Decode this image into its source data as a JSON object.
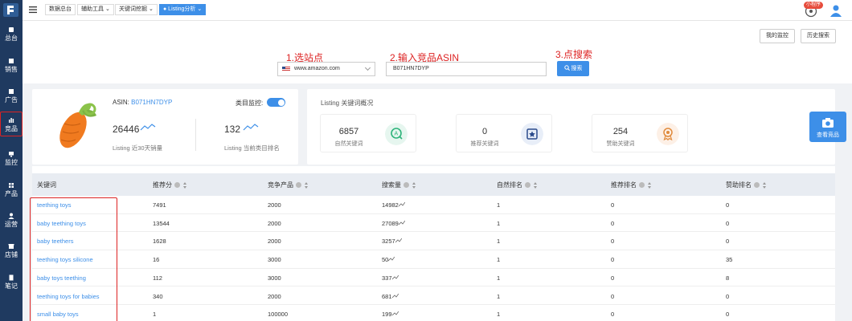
{
  "sidebar": {
    "items": [
      {
        "label": "总台",
        "icon": "dashboard-icon"
      },
      {
        "label": "销售",
        "icon": "sales-icon"
      },
      {
        "label": "广告",
        "icon": "ads-icon"
      },
      {
        "label": "竞品",
        "icon": "competitor-icon",
        "active": true
      },
      {
        "label": "监控",
        "icon": "monitor-icon"
      },
      {
        "label": "产品",
        "icon": "product-icon"
      },
      {
        "label": "运营",
        "icon": "operation-icon"
      },
      {
        "label": "店铺",
        "icon": "store-icon"
      },
      {
        "label": "笔记",
        "icon": "notes-icon"
      }
    ]
  },
  "tabs": [
    {
      "label": "数据总台"
    },
    {
      "label": "辅助工具 ⌄"
    },
    {
      "label": "关键词挖掘 ⌄"
    },
    {
      "label": "● Listing分析 ⌄",
      "active": true
    }
  ],
  "mini_program_badge": "小程序",
  "toolbar": {
    "my_monitor": "我的监控",
    "history_search": "历史搜索"
  },
  "steps": {
    "step1": "1.选站点",
    "step2": "2.输入竞品ASIN",
    "step3": "3.点搜索"
  },
  "search": {
    "site": "www.amazon.com",
    "asin": "B071HN7DYP",
    "button": "搜索"
  },
  "product": {
    "asin_label": "ASIN:",
    "asin": "B071HN7DYP",
    "monitor_label": "类目监控:",
    "monitor_on": true,
    "sales": "26446",
    "sales_label": "Listing 近30天销量",
    "rank": "132",
    "rank_label": "Listing 当前类目排名"
  },
  "keyword_overview": {
    "title": "Listing 关键词概况",
    "cards": [
      {
        "value": "6857",
        "label": "自然关键词"
      },
      {
        "value": "0",
        "label": "推荐关键词"
      },
      {
        "value": "254",
        "label": "赞助关键词"
      }
    ]
  },
  "float_button": "查看竞品",
  "table": {
    "headers": [
      "关键词",
      "推荐分",
      "竞争产品",
      "搜索量",
      "自然排名",
      "推荐排名",
      "赞助排名"
    ],
    "rows": [
      [
        "teething toys",
        "7491",
        "2000",
        "14982",
        "1",
        "0",
        "0"
      ],
      [
        "baby teething toys",
        "13544",
        "2000",
        "27089",
        "1",
        "0",
        "0"
      ],
      [
        "baby teethers",
        "1628",
        "2000",
        "3257",
        "1",
        "0",
        "0"
      ],
      [
        "teething toys silicone",
        "16",
        "3000",
        "50",
        "1",
        "0",
        "35"
      ],
      [
        "baby toys teething",
        "112",
        "3000",
        "337",
        "1",
        "0",
        "8"
      ],
      [
        "teething toys for babies",
        "340",
        "2000",
        "681",
        "1",
        "0",
        "0"
      ],
      [
        "small baby toys",
        "1",
        "100000",
        "199",
        "1",
        "0",
        "0"
      ]
    ]
  },
  "colors": {
    "sidebar": "#1f3a60",
    "accent": "#3d8fe8",
    "highlight": "#d22222"
  }
}
